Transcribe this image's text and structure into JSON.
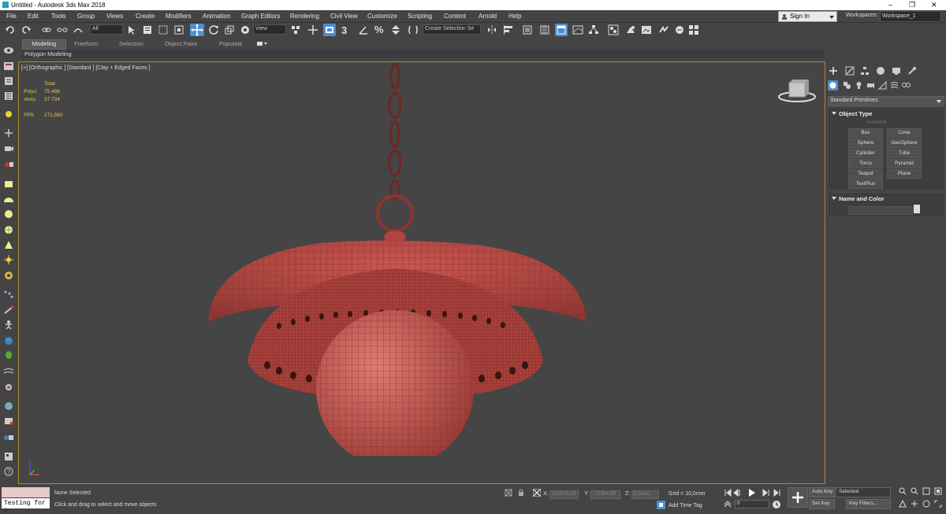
{
  "window": {
    "title": "Untitled - Autodesk 3ds Max 2018",
    "minimize": "–",
    "maximize": "❐",
    "close": "✕"
  },
  "menu": [
    "File",
    "Edit",
    "Tools",
    "Group",
    "Views",
    "Create",
    "Modifiers",
    "Animation",
    "Graph Editors",
    "Rendering",
    "Civil View",
    "Customize",
    "Scripting",
    "Content",
    "Arnold",
    "Help"
  ],
  "account": {
    "sign_in": "Sign In",
    "workspaces_label": "Workspaces:",
    "workspace": "Workspace_1"
  },
  "toolbar": {
    "filter": "All",
    "view": "View",
    "selection_set": "Create Selection Se",
    "snaps_value": "3",
    "angle_symbol": "%"
  },
  "ribbon": {
    "tabs": [
      "Modeling",
      "Freeform",
      "Selection",
      "Object Paint",
      "Populate"
    ],
    "subpanel": "Polygon Modeling"
  },
  "viewport": {
    "label": "[+] [Orthographic ] [Standard ] [Clay + Edged Faces ]",
    "stats": {
      "total_label": "Total",
      "polys_label": "Polys:",
      "polys": "75 488",
      "verts_label": "Verts:",
      "verts": "37 734",
      "fps_label": "FPS:",
      "fps": "171,560"
    }
  },
  "command_panel": {
    "dropdown": "Standard Primitives",
    "object_type_title": "Object Type",
    "autogrid": "AutoGrid",
    "primitives": [
      "Box",
      "Cone",
      "Sphere",
      "GeoSphere",
      "Cylinder",
      "Tube",
      "Torus",
      "Pyramid",
      "Teapot",
      "Plane",
      "TextPlus"
    ],
    "name_color_title": "Name and Color"
  },
  "status": {
    "maxscript_input": "Testing for :",
    "selection": "None Selected",
    "prompt": "Click and drag to select and move objects",
    "x_label": "X:",
    "x": "112870,19",
    "y_label": "Y:",
    "y": "-72384,90",
    "z_label": "Z:",
    "z": "0,0mm",
    "grid": "Grid = 10,0mm",
    "add_time_tag": "Add Time Tag",
    "auto_key": "Auto Key",
    "set_key": "Set Key",
    "key_mode": "Selected",
    "key_filters": "Key Filters...",
    "frame": "0"
  },
  "colors": {
    "accent": "#4a8fd0",
    "mesh": "#b94b45",
    "viewport_border": "#b08a2a",
    "stat_text": "#e8c84a"
  }
}
